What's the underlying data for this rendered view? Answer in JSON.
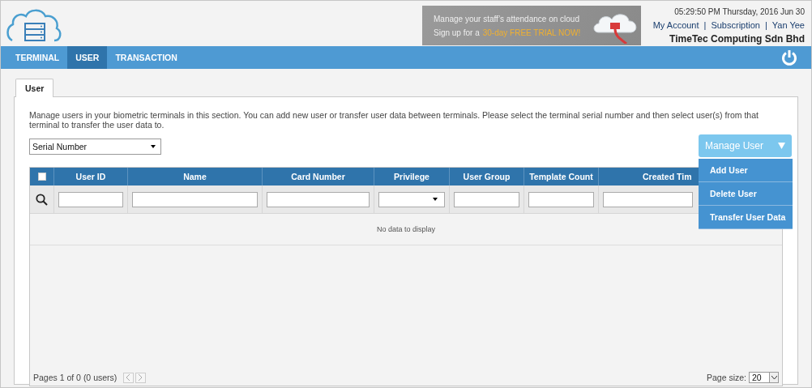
{
  "header": {
    "banner": {
      "line_1": "Manage your staff’s attendance on cloud",
      "line_2": "Sign up for a",
      "offer": "30-day FREE TRIAL NOW!"
    },
    "datetime": "05:29:50 PM Thursday, 2016 Jun 30",
    "account_links": [
      {
        "label": "My Account"
      },
      {
        "label": "|",
        "kind": "separator"
      },
      {
        "label": "Subscription"
      },
      {
        "label": "|",
        "kind": "separator"
      },
      {
        "label": "Yan Yee"
      }
    ],
    "company": "TimeTec Computing Sdn Bhd"
  },
  "nav": [
    {
      "label": "TERMINAL",
      "selected": false
    },
    {
      "label": "USER",
      "selected": true
    },
    {
      "label": "TRANSACTION",
      "selected": false
    }
  ],
  "tabs": [
    {
      "label": "User",
      "selected": true
    }
  ],
  "description": "Manage users in your biometric terminals in this section. You can add new user or transfer user data between terminals. Please select the terminal serial number and then select user(s) from that terminal to transfer the user data to.",
  "serial_select": {
    "value": "Serial Number"
  },
  "manage_menu": {
    "label": "Manage User",
    "expanded": true,
    "items": [
      {
        "label": "Add User"
      },
      {
        "label": "Delete User"
      },
      {
        "label": "Transfer User Data"
      }
    ]
  },
  "table": {
    "select_all": {
      "checked": false
    },
    "columns": [
      {
        "label": "User ID",
        "kind": "text"
      },
      {
        "label": "Name",
        "kind": "text"
      },
      {
        "label": "Card Number",
        "kind": "text"
      },
      {
        "label": "Privilege",
        "kind": "select"
      },
      {
        "label": "User Group",
        "kind": "text"
      },
      {
        "label": "Template Count",
        "kind": "text"
      },
      {
        "label": "Created Tim",
        "kind": "text"
      }
    ],
    "empty_message": "No data to display"
  },
  "pager": {
    "summary": "Pages 1 of 0 (0 users)",
    "page_size_label": "Page size:",
    "page_size": "20"
  }
}
